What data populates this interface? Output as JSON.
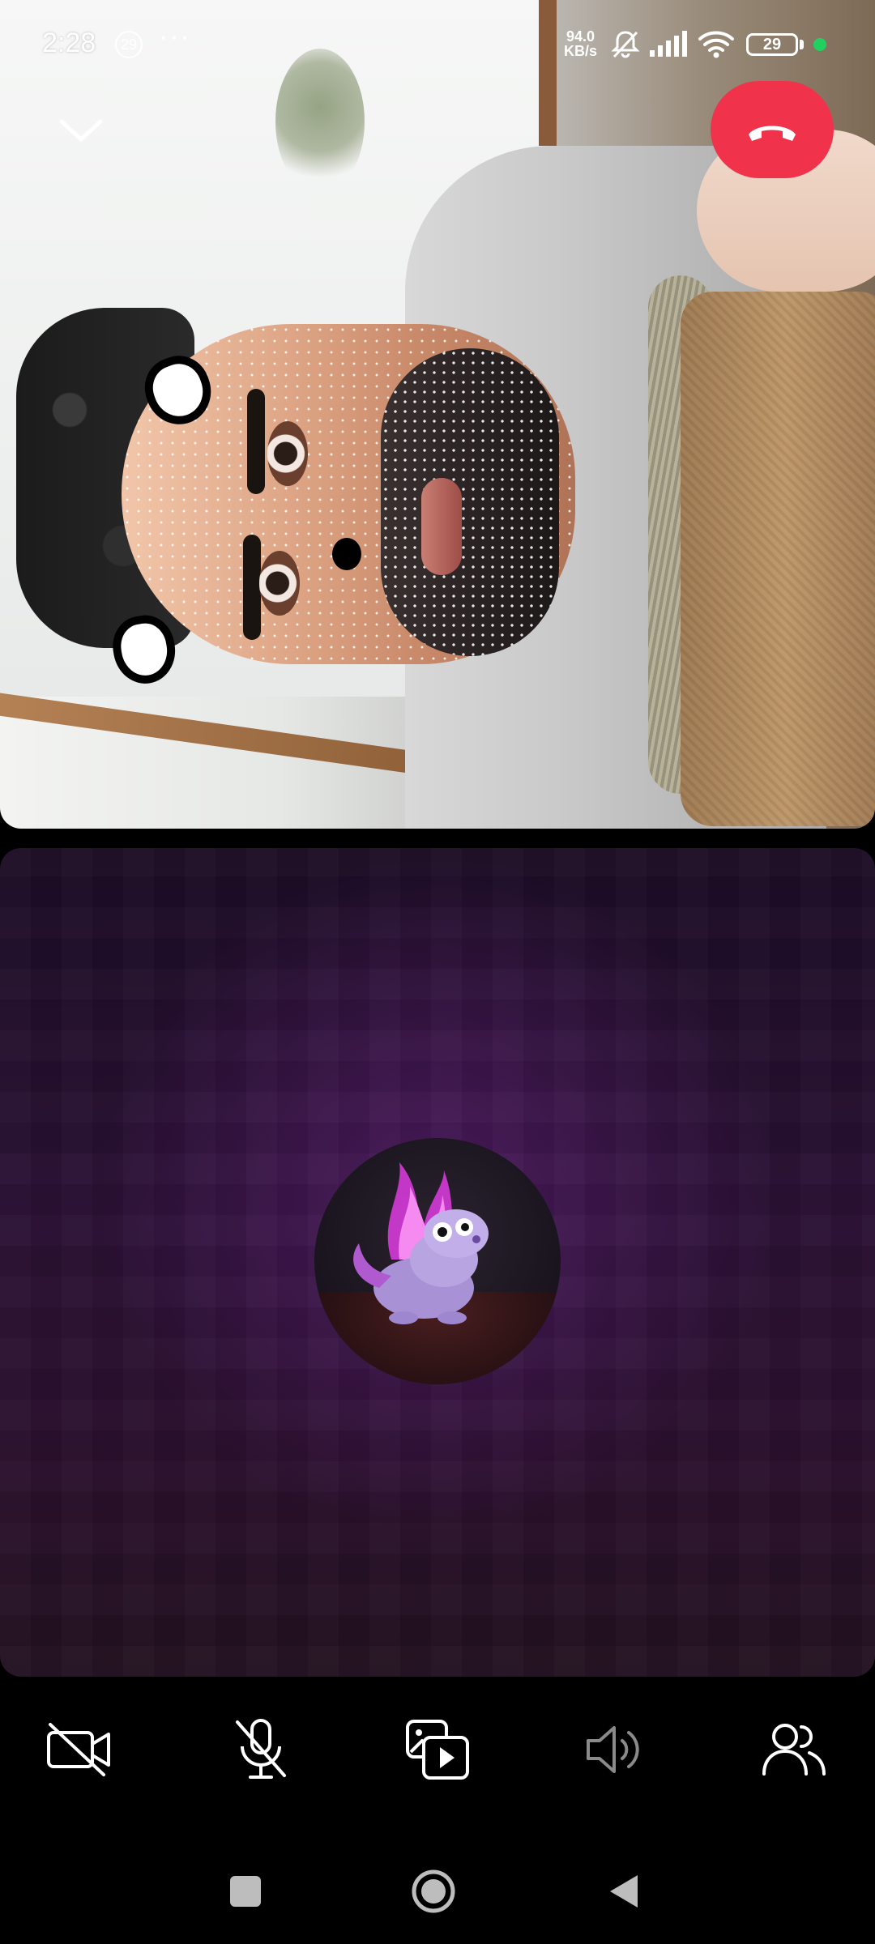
{
  "status_bar": {
    "time": "2:28",
    "notification_count": "29",
    "more_indicator": "···",
    "net_speed_value": "94.0",
    "net_speed_unit": "KB/s",
    "battery_level": "29"
  },
  "call": {
    "remote_video": "camera-feed",
    "local_tile": "camera-off-avatar"
  },
  "controls": [
    {
      "name": "video-off",
      "icon": "video-off-icon"
    },
    {
      "name": "mic-off",
      "icon": "mic-off-icon"
    },
    {
      "name": "share-media",
      "icon": "media-share-icon"
    },
    {
      "name": "speaker",
      "icon": "speaker-icon"
    },
    {
      "name": "participants",
      "icon": "people-icon"
    }
  ],
  "colors": {
    "end_call": "#f0334b",
    "privacy_dot": "#20d160",
    "tile_purple": "#4a1a5c"
  }
}
